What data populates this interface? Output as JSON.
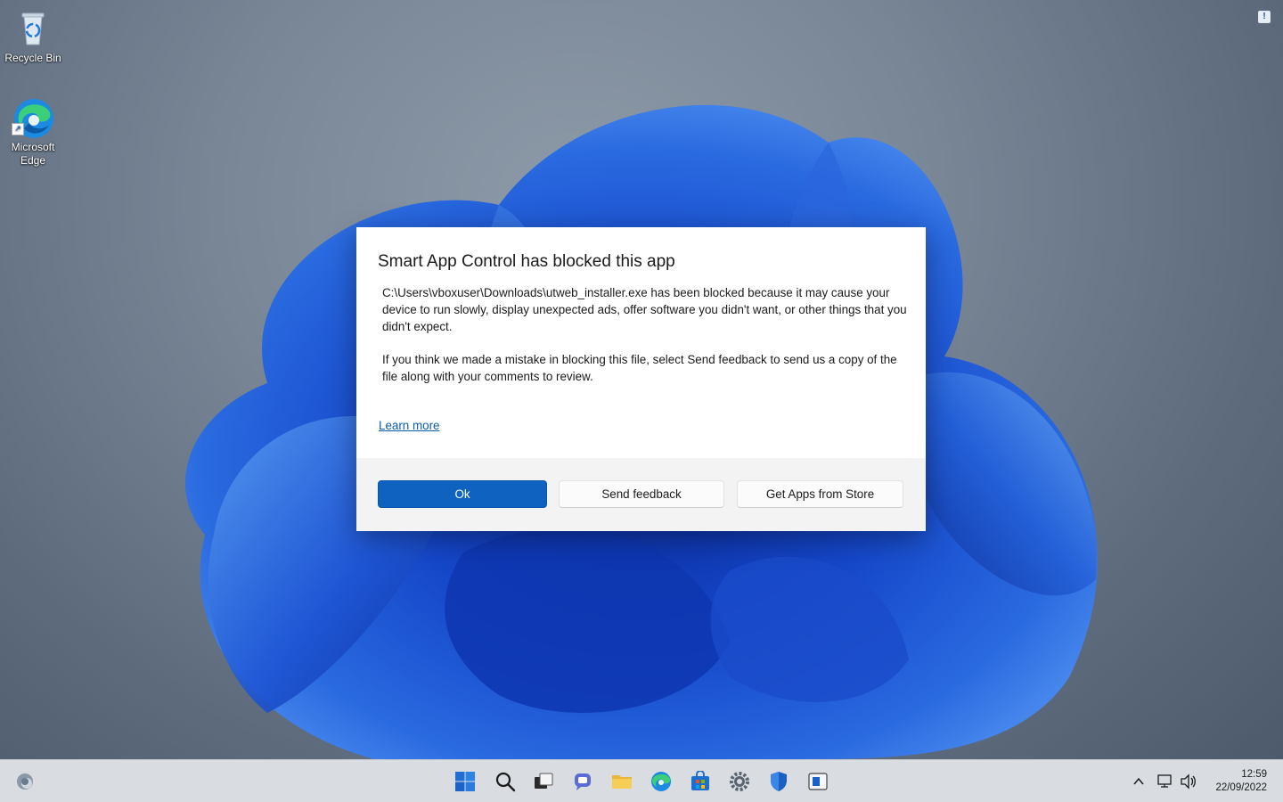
{
  "desktop": {
    "icons": [
      {
        "label": "Recycle Bin",
        "icon": "recycle-bin-icon"
      },
      {
        "label": "Microsoft Edge",
        "icon": "edge-icon"
      }
    ]
  },
  "dialog": {
    "title": "Smart App Control has blocked this app",
    "message1": "C:\\Users\\vboxuser\\Downloads\\utweb_installer.exe has been blocked because it may cause your device to run slowly, display unexpected ads, offer software you didn't want, or other things that you didn't expect.",
    "message2": "If you think we made a mistake in blocking this file, select Send feedback to send us a copy of the file along with your comments to review.",
    "learn_more": "Learn more",
    "buttons": {
      "ok": "Ok",
      "feedback": "Send feedback",
      "store": "Get Apps from Store"
    }
  },
  "taskbar": {
    "items": [
      "widgets-icon",
      "start-icon",
      "search-icon",
      "task-view-icon",
      "chat-icon",
      "file-explorer-icon",
      "edge-icon",
      "store-icon",
      "settings-icon",
      "security-icon",
      "app-icon"
    ],
    "clock": {
      "time": "12:59",
      "date": "22/09/2022"
    }
  },
  "colors": {
    "accent": "#0f62bf",
    "link": "#0b5ca8",
    "footer": "#f3f3f3",
    "taskbar": "#d9dde2"
  }
}
